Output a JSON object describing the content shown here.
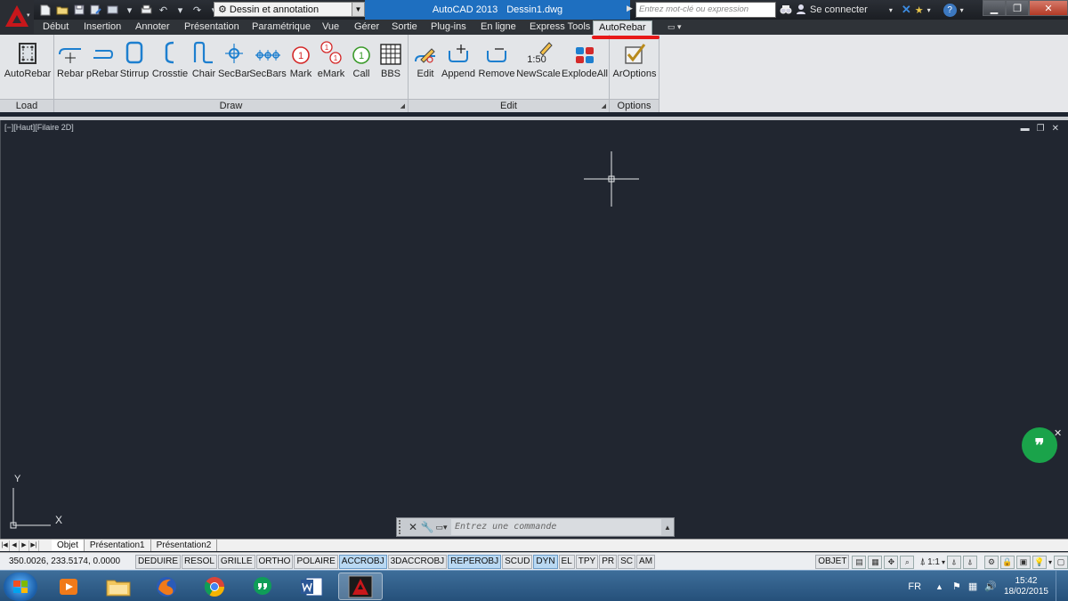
{
  "titlebar": {
    "workspace": "Dessin et annotation",
    "app_name": "AutoCAD 2013",
    "file_name": "Dessin1.dwg",
    "search_placeholder": "Entrez mot-clé ou expression",
    "signin": "Se connecter"
  },
  "ribbon_tabs": [
    {
      "label": "Début"
    },
    {
      "label": "Insertion"
    },
    {
      "label": "Annoter"
    },
    {
      "label": "Présentation"
    },
    {
      "label": "Paramétrique"
    },
    {
      "label": "Vue"
    },
    {
      "label": "Gérer"
    },
    {
      "label": "Sortie"
    },
    {
      "label": "Plug-ins"
    },
    {
      "label": "En ligne"
    },
    {
      "label": "Express Tools"
    },
    {
      "label": "AutoRebar",
      "active": true
    }
  ],
  "panels": {
    "load": {
      "label": "Load",
      "tools": [
        "AutoRebar"
      ]
    },
    "draw": {
      "label": "Draw",
      "tools": [
        "Rebar",
        "pRebar",
        "Stirrup",
        "Crosstie",
        "Chair",
        "SecBar",
        "SecBars",
        "Mark",
        "eMark",
        "Call",
        "BBS"
      ]
    },
    "edit": {
      "label": "Edit",
      "tools": [
        "Edit",
        "Append",
        "Remove",
        "NewScale",
        "ExplodeAll"
      ]
    },
    "options": {
      "label": "Options",
      "tools": [
        "ArOptions"
      ]
    }
  },
  "icon_text": {
    "mark": "1",
    "call": "1",
    "newscale": "1:50"
  },
  "viewport": {
    "label": "[−][Haut][Filaire 2D]",
    "axis_y": "Y",
    "axis_x": "X"
  },
  "command": {
    "placeholder": "Entrez une commande"
  },
  "layout_tabs": [
    "Objet",
    "Présentation1",
    "Présentation2"
  ],
  "status": {
    "coords": "350.0026, 233.5174, 0.0000",
    "toggles": [
      {
        "label": "DEDUIRE",
        "on": false
      },
      {
        "label": "RESOL",
        "on": false
      },
      {
        "label": "GRILLE",
        "on": false
      },
      {
        "label": "ORTHO",
        "on": false
      },
      {
        "label": "POLAIRE",
        "on": false
      },
      {
        "label": "ACCROBJ",
        "on": true
      },
      {
        "label": "3DACCROBJ",
        "on": false
      },
      {
        "label": "REPEROBJ",
        "on": true
      },
      {
        "label": "SCUD",
        "on": false
      },
      {
        "label": "DYN",
        "on": true
      },
      {
        "label": "EL",
        "on": false
      },
      {
        "label": "TPY",
        "on": false
      },
      {
        "label": "PR",
        "on": false
      },
      {
        "label": "SC",
        "on": false
      },
      {
        "label": "AM",
        "on": false
      }
    ],
    "space": "OBJET",
    "scale": "1:1"
  },
  "taskbar": {
    "language": "FR",
    "time": "15:42",
    "date": "18/02/2015"
  },
  "colors": {
    "accent_red": "#e81919",
    "icon_blue": "#1d7fcf",
    "mark_red": "#d42a2a",
    "call_green": "#3a9a2a",
    "drawing_bg": "#212630"
  }
}
